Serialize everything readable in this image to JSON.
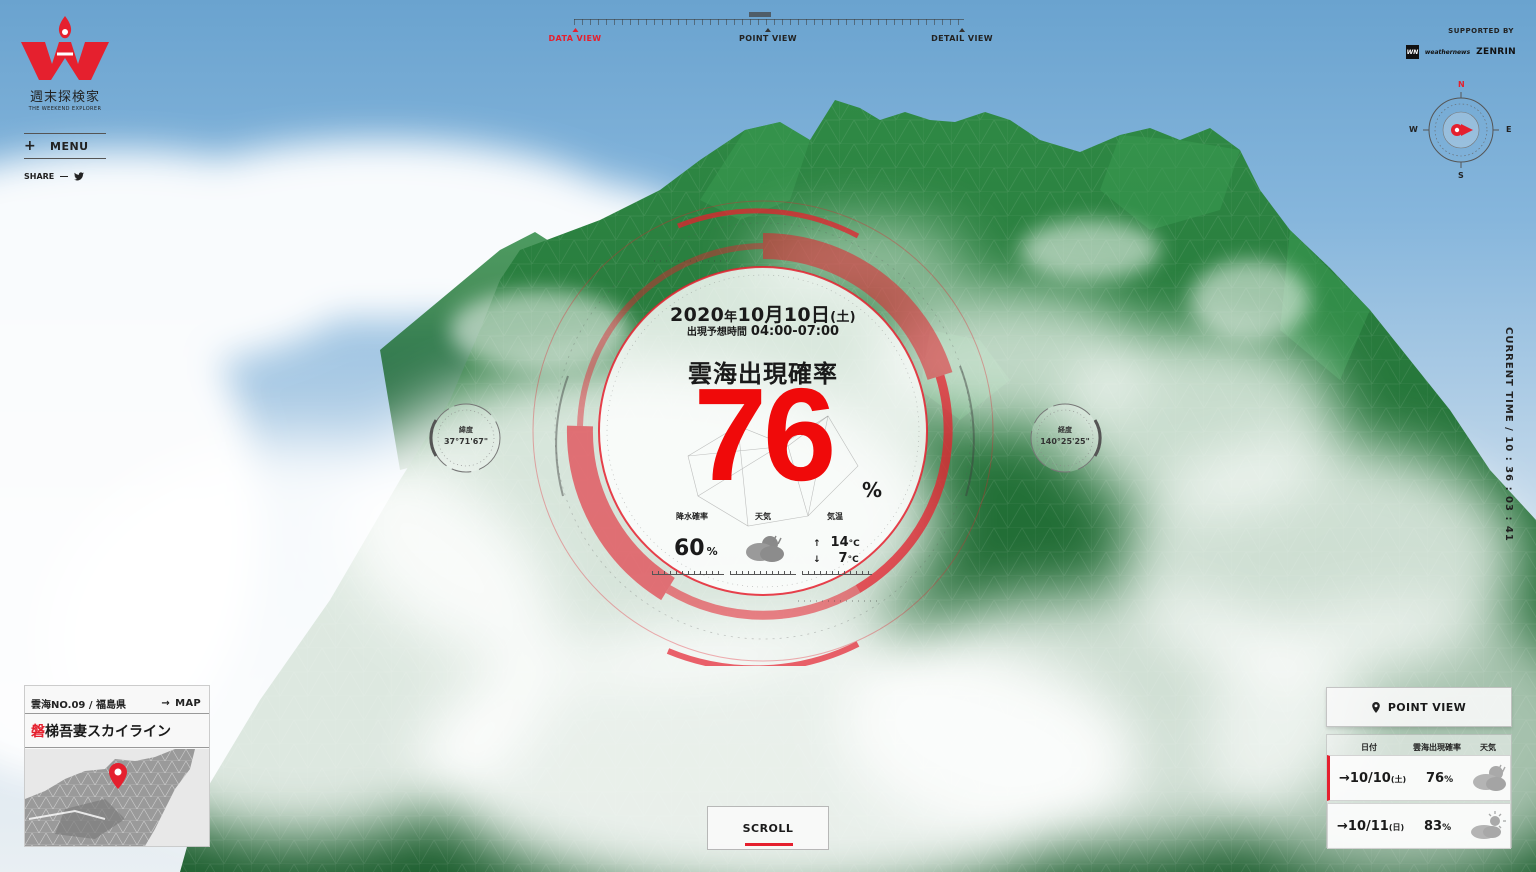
{
  "brand": {
    "name_jp": "週末探検家",
    "name_en": "THE WEEKEND EXPLORER",
    "accent": "#e5202e"
  },
  "menu": {
    "label": "MENU",
    "icon": "plus-icon"
  },
  "share": {
    "label": "SHARE",
    "icon": "twitter-icon"
  },
  "nav": {
    "items": [
      {
        "label": "DATA VIEW",
        "active": true
      },
      {
        "label": "POINT VIEW",
        "active": false
      },
      {
        "label": "DETAIL VIEW",
        "active": false
      }
    ]
  },
  "sponsor": {
    "label": "SUPPORTED BY",
    "logo1_mark": "WN",
    "logo1_text": "weathernews",
    "logo2": "ZENRIN"
  },
  "compass": {
    "n": "N",
    "e": "E",
    "s": "S",
    "w": "W"
  },
  "forecast": {
    "date_year": "2020",
    "date_year_suffix": "年",
    "date_md": "10月10日",
    "date_dow": "(土)",
    "time_label": "出現予想時間",
    "time_range": "04:00-07:00",
    "title": "雲海出現確率",
    "probability": "76",
    "probability_unit": "%",
    "precip_label": "降水確率",
    "precip_value": "60",
    "precip_unit": "%",
    "weather_label": "天気",
    "weather_icon": "cloud-rain-icon",
    "temp_label": "気温",
    "temp_high": "14",
    "temp_low": "7",
    "temp_unit": "°C",
    "temp_high_arrow": "↑",
    "temp_low_arrow": "↓"
  },
  "coords": {
    "lat_label": "緯度",
    "lat_value": "37°71'67\"",
    "lon_label": "経度",
    "lon_value": "140°25'25\""
  },
  "current_time": {
    "text": "CURRENT TIME / 10 : 36 : 03 : 41"
  },
  "location": {
    "number": "雲海NO.09 / 福島県",
    "map_label": "MAP",
    "map_arrow": "→",
    "name_first": "磐",
    "name_rest": "梯吾妻スカイライン",
    "pin_icon": "map-pin-icon"
  },
  "scroll": {
    "label": "SCROLL"
  },
  "point_view": {
    "label": "POINT VIEW",
    "icon": "map-pin-icon"
  },
  "table": {
    "headers": {
      "date": "日付",
      "rate": "雲海出現確率",
      "weather": "天気"
    },
    "rows": [
      {
        "arrow": "→",
        "date": "10/10",
        "dow": "(土)",
        "rate": "76",
        "unit": "%",
        "icon": "cloud-rain-icon",
        "selected": true
      },
      {
        "arrow": "→",
        "date": "10/11",
        "dow": "(日)",
        "rate": "83",
        "unit": "%",
        "icon": "sun-cloud-icon",
        "selected": false
      }
    ]
  }
}
